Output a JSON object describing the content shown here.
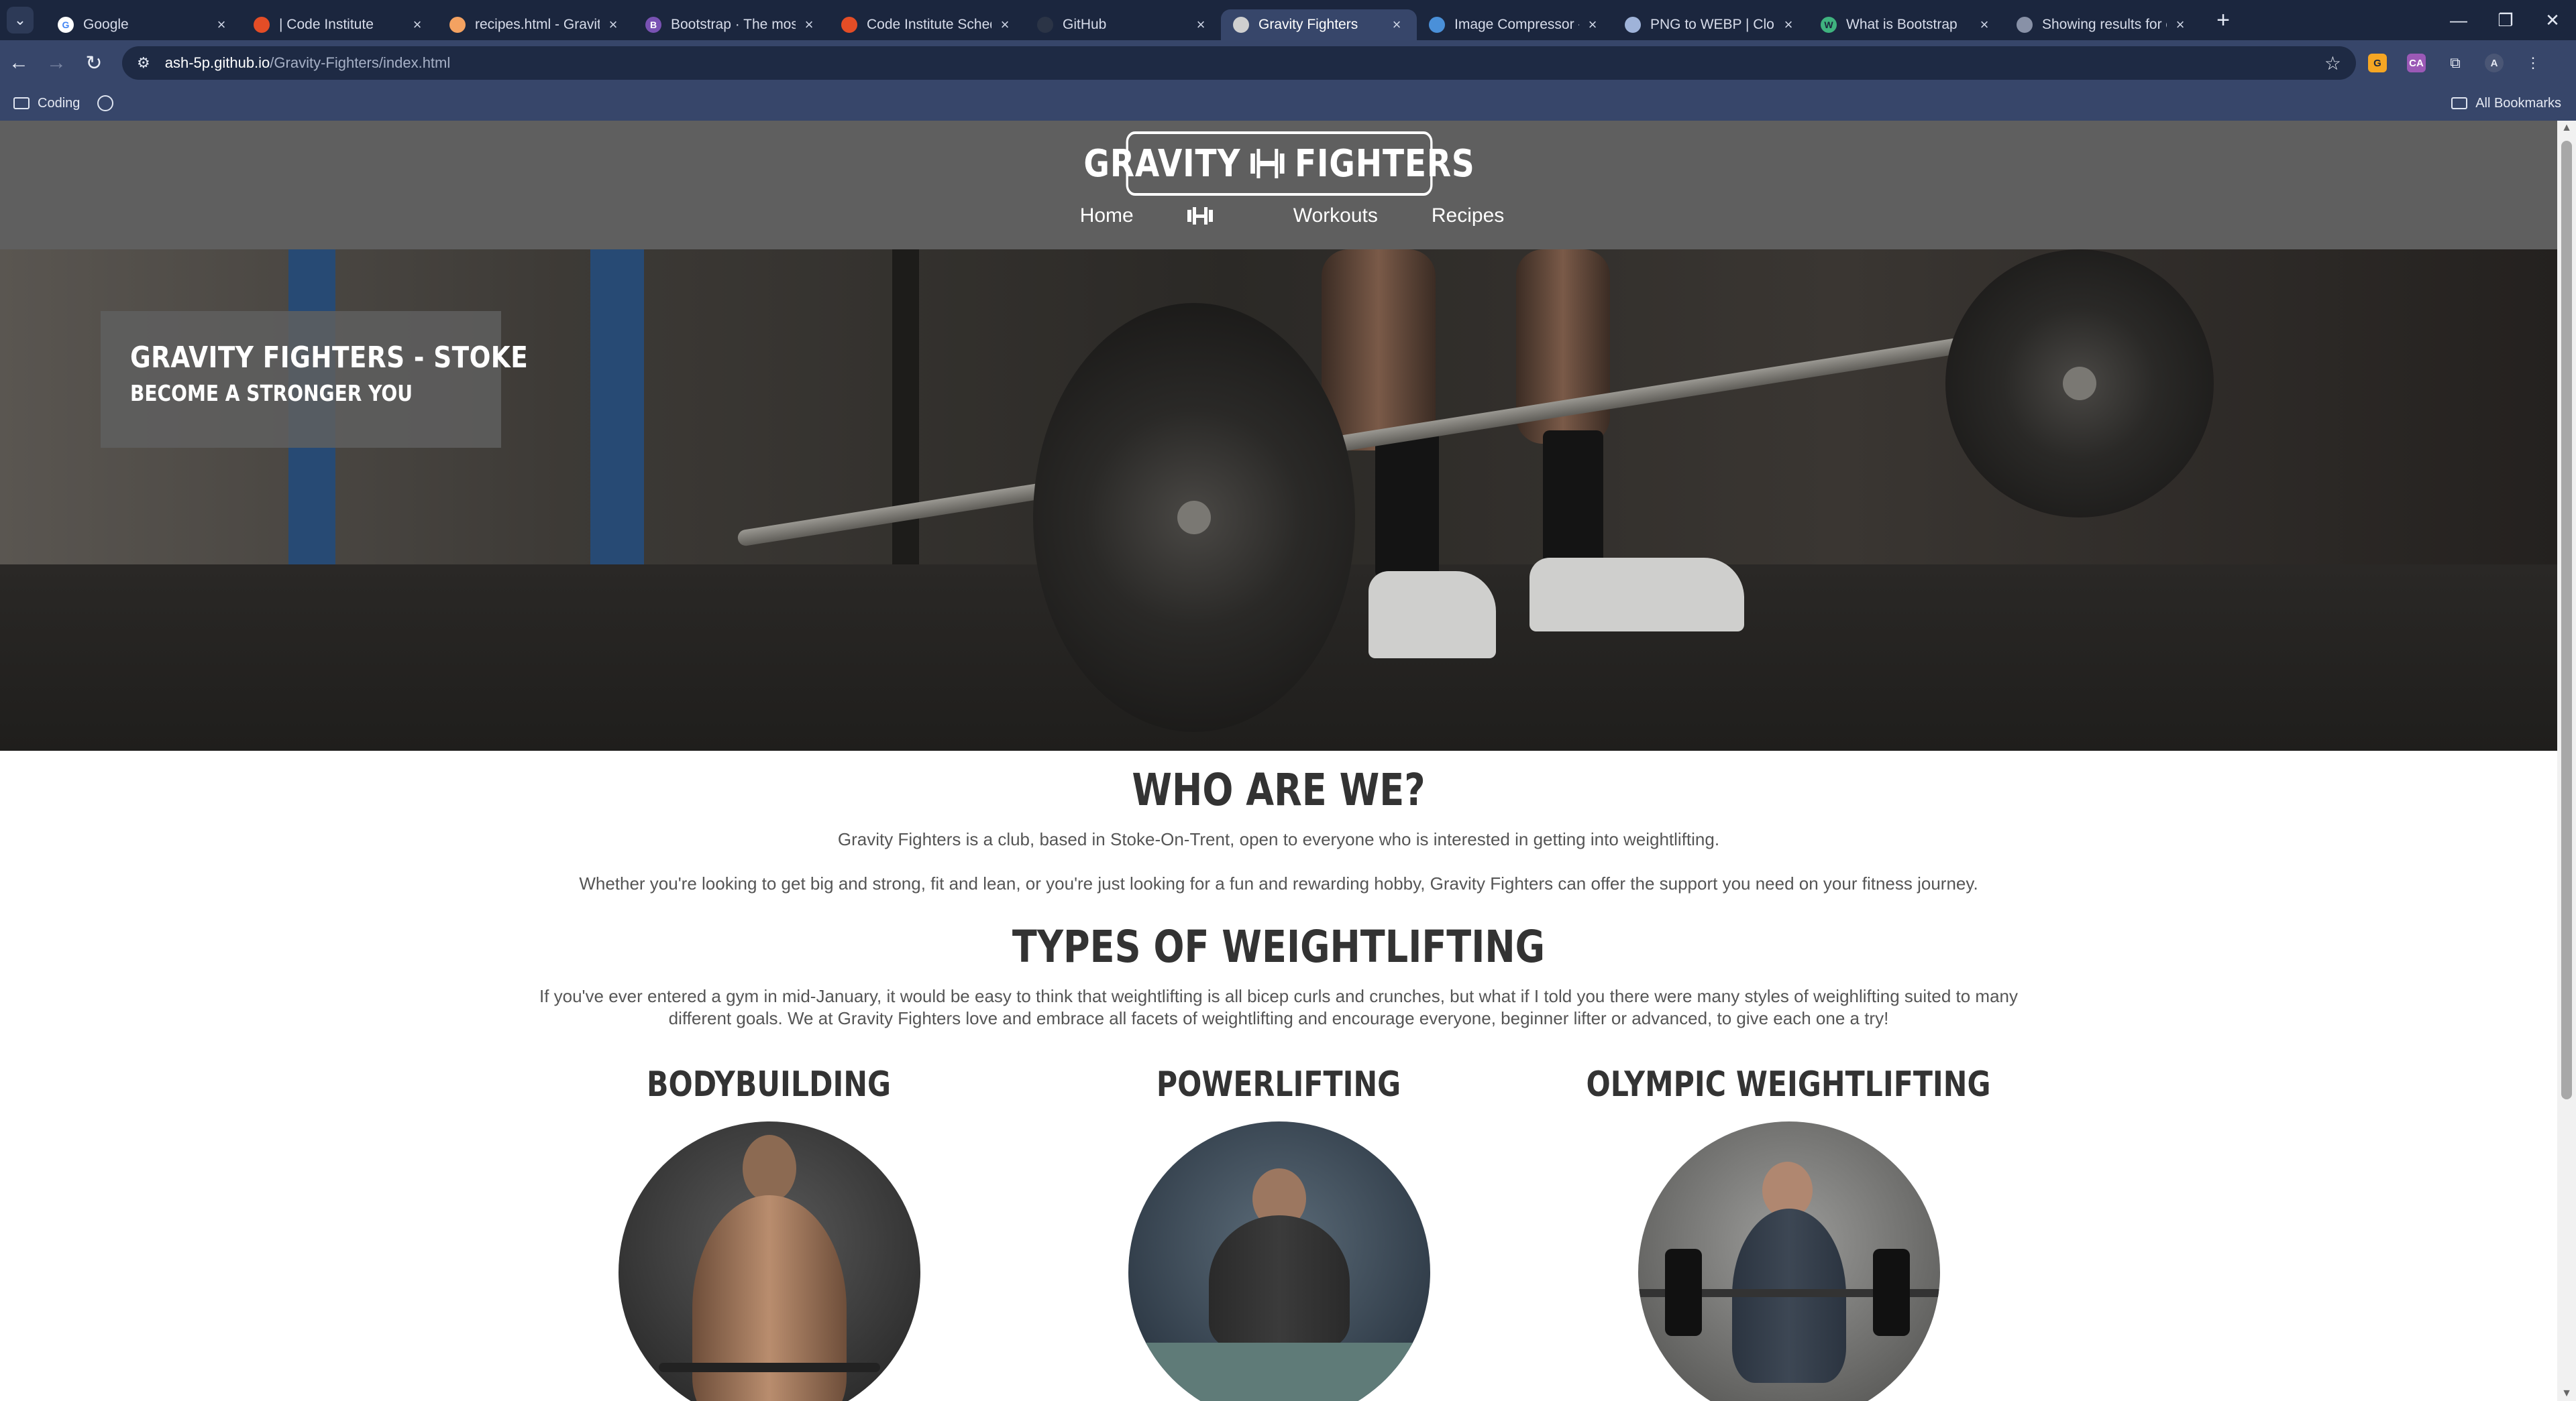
{
  "browser": {
    "tabs": [
      {
        "title": "Google",
        "fav_color": "#ffffff",
        "fav_text": "G",
        "fav_text_color": "#4285f4"
      },
      {
        "title": "| Code Institute",
        "fav_color": "#e44d26",
        "fav_text": "",
        "fav_text_color": "#ffffff"
      },
      {
        "title": "recipes.html - Gravity-Figh",
        "fav_color": "#f4a261",
        "fav_text": "",
        "fav_text_color": "#ffffff"
      },
      {
        "title": "Bootstrap · The most popu",
        "fav_color": "#7952b3",
        "fav_text": "B",
        "fav_text_color": "#ffffff"
      },
      {
        "title": "Code Institute Schedule G",
        "fav_color": "#e44d26",
        "fav_text": "",
        "fav_text_color": "#ffffff"
      },
      {
        "title": "GitHub",
        "fav_color": "#2b3446",
        "fav_text": "",
        "fav_text_color": "#ffffff"
      },
      {
        "title": "Gravity Fighters",
        "fav_color": "#cfcfcf",
        "fav_text": "",
        "fav_text_color": "#333333",
        "active": true
      },
      {
        "title": "Image Compressor - Com",
        "fav_color": "#4a90d9",
        "fav_text": "",
        "fav_text_color": "#ffffff"
      },
      {
        "title": "PNG to WEBP | CloudCon",
        "fav_color": "#9fb3d9",
        "fav_text": "",
        "fav_text_color": "#ffffff"
      },
      {
        "title": "What is Bootstrap",
        "fav_color": "#3fb37f",
        "fav_text": "W",
        "fav_text_color": "#1b263e"
      },
      {
        "title": "Showing results for conte",
        "fav_color": "#8891a7",
        "fav_text": "",
        "fav_text_color": "#ffffff"
      }
    ],
    "new_tab_symbol": "+",
    "window_controls": [
      "—",
      "❐",
      "✕"
    ],
    "url_host": "ash-5p.github.io",
    "url_path": "/Gravity-Fighters/index.html",
    "bookmark_folder": "Coding",
    "all_bookmarks": "All Bookmarks",
    "profile_initial": "A"
  },
  "site": {
    "logo_left": "GRAVITY",
    "logo_right": "FIGHTERS",
    "nav": [
      "Home",
      "Workouts",
      "Recipes"
    ],
    "hero_title": "GRAVITY FIGHTERS - STOKE",
    "hero_subtitle": "BECOME A STRONGER YOU",
    "about_title": "WHO ARE WE?",
    "about_p1": "Gravity Fighters is a club, based in Stoke-On-Trent, open to everyone who is interested in getting into weightlifting.",
    "about_p2": "Whether you're looking to get big and strong, fit and lean, or you're just looking for a fun and rewarding hobby, Gravity Fighters can offer the support you need on your fitness journey.",
    "types_title": "TYPES OF WEIGHTLIFTING",
    "types_p": "If you've ever entered a gym in mid-January, it would be easy to think that weightlifting is all bicep curls and crunches, but what if I told you there were many styles of weighlifting suited to many different goals. We at Gravity Fighters love and embrace all facets of weightlifting and encourage everyone, beginner lifter or advanced, to give each one a try!",
    "columns": [
      "BODYBUILDING",
      "POWERLIFTING",
      "OLYMPIC WEIGHTLIFTING"
    ]
  },
  "colors": {
    "tabstrip": "#1b263e",
    "toolbar": "#37466a",
    "site_header": "#5f5f5f",
    "heading_text": "#333333"
  }
}
